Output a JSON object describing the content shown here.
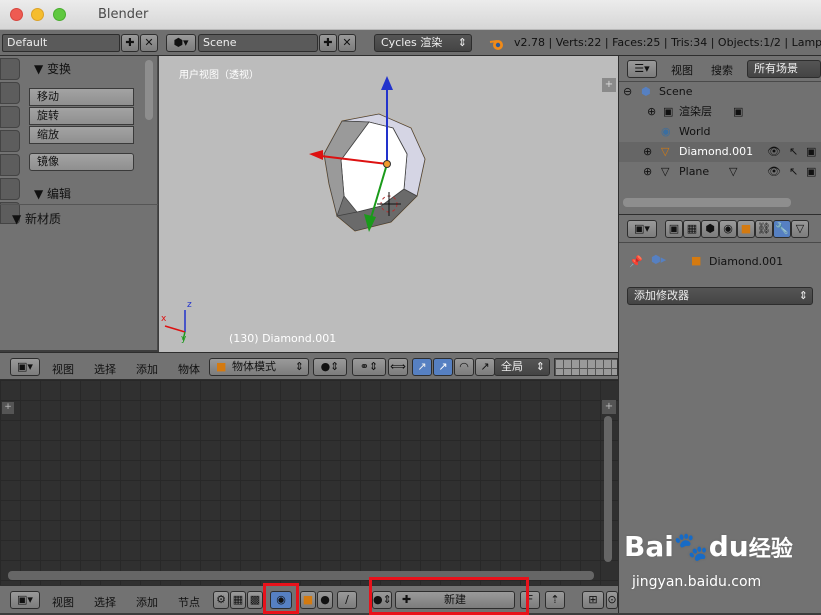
{
  "window": {
    "title": "Blender"
  },
  "header": {
    "layout": "Default",
    "scene": "Scene",
    "render_engine": "Cycles 渲染",
    "stats": "v2.78 | Verts:22 | Faces:25 | Tris:34 | Objects:1/2 | Lamps:0/0"
  },
  "toolshelf": {
    "transform_title": "变换",
    "buttons": [
      "移动",
      "旋转",
      "缩放"
    ],
    "mirror": "镜像",
    "edit_title": "编辑",
    "new_material_title": "新材质"
  },
  "viewport": {
    "view_label": "用户视图（透视）",
    "object_label": "(130) Diamond.001",
    "axes": {
      "x": "x",
      "y": "y",
      "z": "z"
    }
  },
  "view3d_header": {
    "menus": [
      "视图",
      "选择",
      "添加",
      "物体"
    ],
    "mode": "物体模式",
    "orientation": "全局"
  },
  "outliner": {
    "menus": [
      "视图",
      "搜索"
    ],
    "filter": "所有场景",
    "items": [
      "Scene",
      "渲染层",
      "World",
      "Diamond.001",
      "Plane"
    ]
  },
  "properties": {
    "object_name": "Diamond.001",
    "add_modifier": "添加修改器"
  },
  "node_header": {
    "menus": [
      "视图",
      "选择",
      "添加",
      "节点"
    ],
    "new_button": "新建"
  },
  "watermark": {
    "brand": "Bai",
    "paw": "du",
    "suffix": "经验",
    "url": "jingyan.baidu.com"
  },
  "colors": {
    "highlight": "#e8121b",
    "accent": "#5680c2",
    "orange": "#f09a2c"
  }
}
